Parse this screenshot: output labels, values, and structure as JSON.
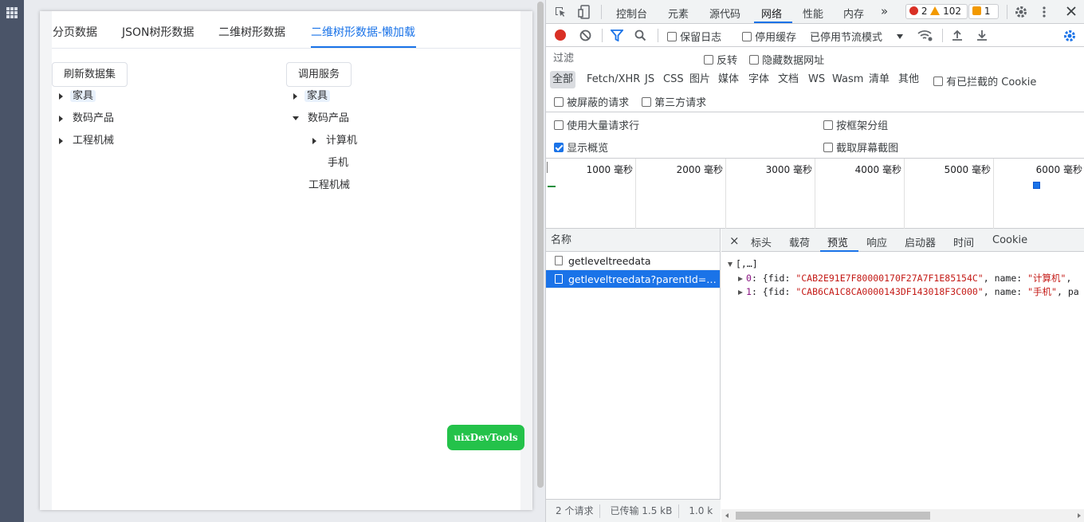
{
  "app": {
    "tabs": [
      "分页数据",
      "JSON树形数据",
      "二维树形数据",
      "二维树形数据-懒加载"
    ],
    "active_tab_index": 3,
    "left": {
      "button": "刷新数据集",
      "nodes": [
        {
          "label": "家具",
          "expanded": false
        },
        {
          "label": "数码产品",
          "expanded": false
        },
        {
          "label": "工程机械",
          "expanded": false
        }
      ]
    },
    "right": {
      "button": "调用服务",
      "nodes": [
        {
          "label": "家具",
          "expanded": false
        },
        {
          "label": "数码产品",
          "expanded": true
        },
        {
          "label": "计算机",
          "expanded": false
        },
        {
          "label": "手机"
        },
        {
          "label": "工程机械"
        }
      ]
    },
    "fab_label": "uixDevTools"
  },
  "devtools": {
    "top_tabs": [
      "控制台",
      "元素",
      "源代码",
      "网络",
      "性能",
      "内存"
    ],
    "active_top_tab": "网络",
    "more_symbol": "»",
    "error_count": "2",
    "warning_count": "102",
    "info_count": "1",
    "toolbar": {
      "preserve_log": "保留日志",
      "disable_cache": "停用缓存",
      "throttle": "已停用节流模式"
    },
    "filter": {
      "placeholder": "过滤",
      "invert": "反转",
      "hide_data_urls": "隐藏数据网址"
    },
    "types": [
      "全部",
      "Fetch/XHR",
      "JS",
      "CSS",
      "图片",
      "媒体",
      "字体",
      "文档",
      "WS",
      "Wasm",
      "清单",
      "其他"
    ],
    "blocked_cookies": "有已拦截的 Cookie",
    "blocked_requests": "被屏蔽的请求",
    "third_party": "第三方请求",
    "options": {
      "big_rows": "使用大量请求行",
      "group_by_frame": "按框架分组",
      "show_overview": "显示概览",
      "capture_screenshots": "截取屏幕截图"
    },
    "timeline_labels": [
      "1000 毫秒",
      "2000 毫秒",
      "3000 毫秒",
      "4000 毫秒",
      "5000 毫秒",
      "6000 毫秒"
    ],
    "name_header": "名称",
    "requests": [
      {
        "name": "getleveltreedata",
        "selected": false
      },
      {
        "name": "getleveltreedata?parentId=CA...",
        "selected": true
      }
    ],
    "footer": {
      "count": "2 个请求",
      "transferred": "已传输 1.5 kB",
      "resources": "1.0 k"
    },
    "detail_tabs": [
      "标头",
      "载荷",
      "预览",
      "响应",
      "启动器",
      "时间",
      "Cookie"
    ],
    "active_detail_tab": "预览",
    "close_symbol": "×",
    "preview": {
      "root": "[,…]",
      "rows": [
        {
          "index": "0",
          "fid": "\"CAB2E91E7F80000170F27A7F1E85154C\"",
          "name": "\"计算机\"",
          "tail": ","
        },
        {
          "index": "1",
          "fid": "\"CAB6CA1C8CA0000143DF143018F3C000\"",
          "name": "\"手机\"",
          "tail": ", pa"
        }
      ]
    }
  }
}
